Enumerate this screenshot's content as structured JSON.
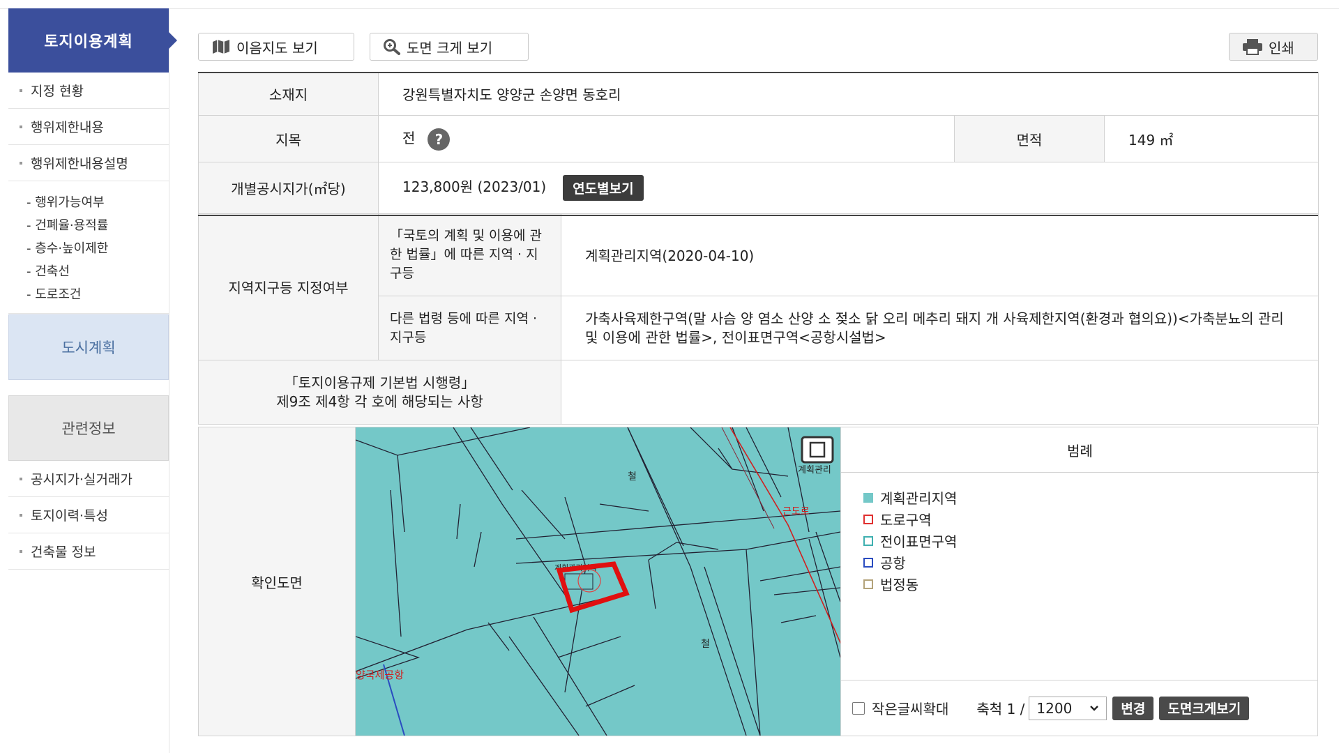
{
  "sidebar": {
    "header": "토지이용계획",
    "items_top": [
      "지정 현황",
      "행위제한내용",
      "행위제한내용설명"
    ],
    "sub_items": [
      "- 행위가능여부",
      "- 건폐율·용적률",
      "- 층수·높이제한",
      "- 건축선",
      "- 도로조건"
    ],
    "city_plan": "도시계획",
    "related": "관련정보",
    "items_bottom": [
      "공시지가·실거래가",
      "토지이력·특성",
      "건축물 정보"
    ]
  },
  "toolbar": {
    "map_button": "이음지도 보기",
    "zoom_button": "도면 크게 보기",
    "print_button": "인쇄"
  },
  "info": {
    "location_label": "소재지",
    "location_value": "강원특별자치도 양양군 손양면 동호리",
    "land_category_label": "지목",
    "land_category_value": "전",
    "help_glyph": "?",
    "area_label": "면적",
    "area_value": "149 ㎡",
    "price_label": "개별공시지가(㎡당)",
    "price_value": "123,800원 (2023/01)",
    "price_year_button": "연도별보기",
    "zone_label": "지역지구등 지정여부",
    "zone_row1_label": "「국토의 계획 및 이용에 관한 법률」에 따른 지역 · 지구등",
    "zone_row1_value": "계획관리지역(2020-04-10)",
    "zone_row2_label": "다른 법령 등에 따른 지역 · 지구등",
    "zone_row2_value": "가축사육제한구역(말 사슴 양 염소 산양 소 젖소 닭 오리 메추리 돼지 개 사육제한지역(환경과 협의요))<가축분뇨의 관리 및 이용에 관한 법률>, 전이표면구역<공항시설법>",
    "decree_label_line1": "「토지이용규제 기본법 시행령」",
    "decree_label_line2": "제9조 제4항 각 호에 해당되는 사항",
    "decree_value": ""
  },
  "map": {
    "label": "확인도면",
    "map_texts": {
      "plan_zone": "계획관리",
      "plan_zone_short": "계획관리지역",
      "road": "근도로",
      "airport": "양국제공항",
      "railway": "철"
    },
    "legend_title": "범례",
    "legend": [
      {
        "label": "계획관리지역",
        "color": "#74c8c8",
        "style": "fill"
      },
      {
        "label": "도로구역",
        "color": "#e03030",
        "style": "outline"
      },
      {
        "label": "전이표면구역",
        "color": "#3fb0b0",
        "style": "outline"
      },
      {
        "label": "공항",
        "color": "#2a4cc0",
        "style": "outline"
      },
      {
        "label": "법정동",
        "color": "#b3a37a",
        "style": "outline"
      }
    ],
    "small_text_label": "작은글씨확대",
    "scale_label": "축척 1 /",
    "scale_value": "1200",
    "change_button": "변경",
    "enlarge_button": "도면크게보기"
  }
}
